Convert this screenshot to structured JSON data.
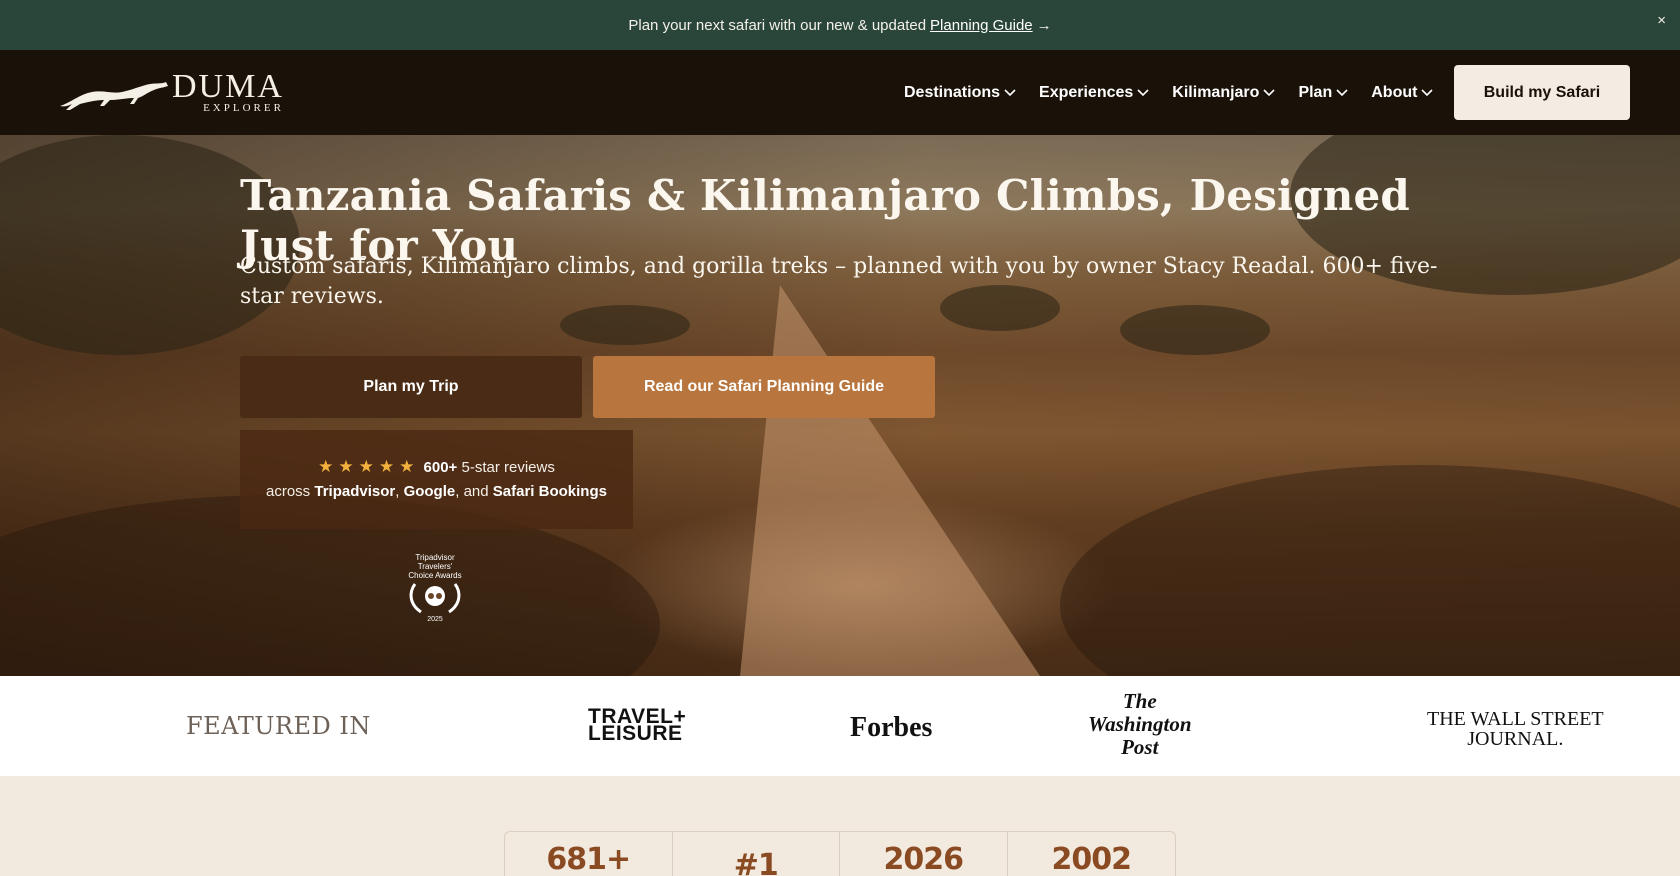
{
  "announcement": {
    "text": "Plan your next safari with our new & updated",
    "link": "Planning Guide",
    "arrow": "→",
    "close": "×"
  },
  "logo": {
    "word": "DUMA",
    "sub": "EXPLORER"
  },
  "nav": {
    "items": [
      {
        "label": "Destinations"
      },
      {
        "label": "Experiences"
      },
      {
        "label": "Kilimanjaro"
      },
      {
        "label": "Plan"
      },
      {
        "label": "About"
      }
    ],
    "cta": "Build my Safari"
  },
  "hero": {
    "title": "Tanzania Safaris & Kilimanjaro Climbs, Designed Just for You",
    "subtitle": "Custom safaris, Kilimanjaro climbs, and gorilla treks – planned with you by owner Stacy Readal. 600+ five-star reviews.",
    "primary_button": "Plan my Trip",
    "secondary_button": "Read our Safari Planning Guide",
    "reviews": {
      "stars": "★★★★★",
      "count": "600+",
      "count_suffix": "5-star reviews",
      "across": "across",
      "site1": "Tripadvisor",
      "sep1": ",",
      "site2": "Google",
      "sep2": ", and",
      "site3": "Safari Bookings"
    },
    "award": {
      "line1": "Tripadvisor",
      "line2": "Travelers'",
      "line3": "Choice Awards",
      "year": "2025"
    }
  },
  "featured": {
    "label": "FEATURED IN",
    "logos": {
      "travel_leisure_1": "TRAVEL+",
      "travel_leisure_2": "LEISURE",
      "forbes": "Forbes",
      "wapo_1": "The",
      "wapo_2": "Washington",
      "wapo_3": "Post",
      "wsj_1": "THE WALL STREET",
      "wsj_2": "JOURNAL."
    }
  },
  "stats": [
    "681+",
    "#1",
    "2026",
    "2002"
  ],
  "colors": {
    "announcement_bg": "#2a4539",
    "nav_bg": "#1a1109",
    "primary_button": "#4a2c16",
    "secondary_button": "#b8753e",
    "star": "#f2b13c",
    "stat_text": "#8a4a22"
  }
}
